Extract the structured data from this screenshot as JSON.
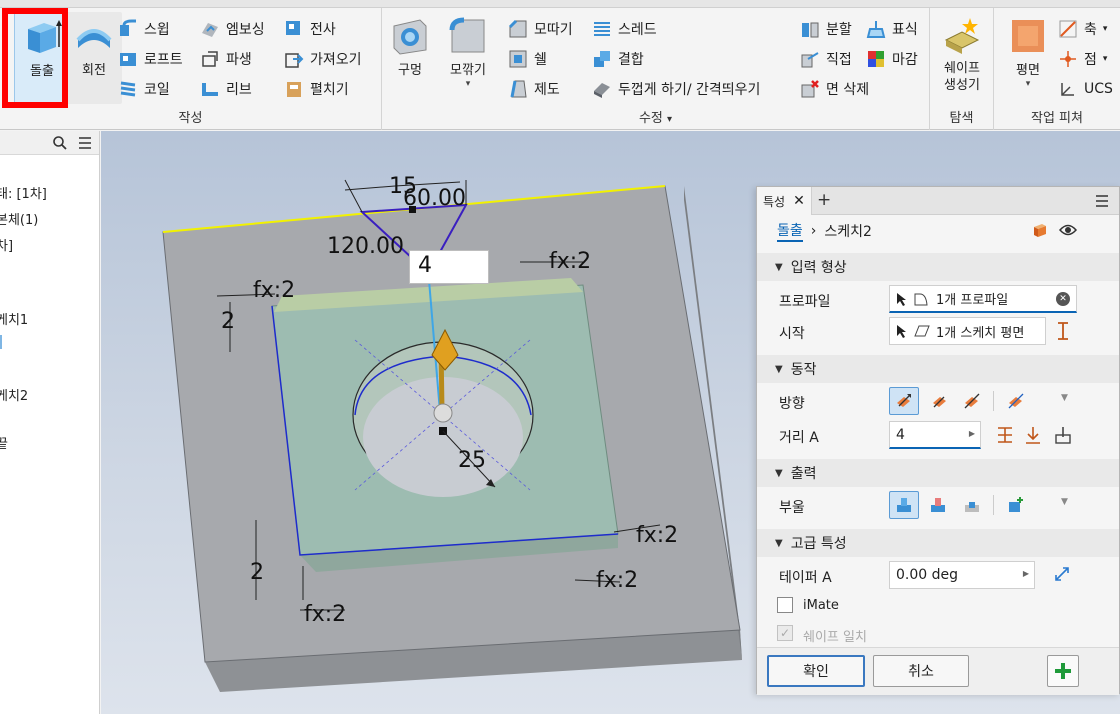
{
  "ribbon": {
    "groups": {
      "create_label": "작성",
      "modify_label": "수정",
      "explore_label": "탐색",
      "workfeature_label": "작업 피쳐"
    },
    "create": {
      "extrude": "돌출",
      "revolve": "회전",
      "sweep": "스윕",
      "loft": "로프트",
      "coil": "코일",
      "emboss": "엠보싱",
      "derive": "파생",
      "rib": "리브",
      "decal": "전사",
      "import": "가져오기",
      "unfold": "펼치기"
    },
    "modify": {
      "hole": "구멍",
      "fillet": "모깎기",
      "chamfer": "모따기",
      "shell": "쉘",
      "draft": "제도",
      "thread": "스레드",
      "combine": "결합",
      "thicken": "두껍게 하기/ 간격띄우기",
      "split": "분할",
      "direct": "직접",
      "delete_face": "면 삭제",
      "mark": "표식",
      "finish": "마감"
    },
    "explore": {
      "shape_generator": "쉐이프\n생성기"
    },
    "workfeatures": {
      "plane": "평면",
      "axis": "축",
      "point": "점",
      "ucs": "UCS"
    }
  },
  "browser": {
    "items": [
      "태: [1차]",
      "본체(1)",
      "차]",
      "케치1",
      "케치2",
      "끝"
    ]
  },
  "viewport": {
    "dims": {
      "chamfer_small": "15",
      "angle_60": "60.00",
      "angle_120": "120.00",
      "distance_input": "4",
      "fx_top_right": "fx:2",
      "fx_top_left": "fx:2",
      "left_top": "2",
      "left_bottom": "2",
      "fx_bottom_left": "fx:2",
      "fx_right_1": "fx:2",
      "fx_right_2": "fx:2",
      "hole_dia": "25"
    }
  },
  "properties": {
    "tab_label": "특성",
    "breadcrumb_feature": "돌출",
    "breadcrumb_sketch": "스케치2",
    "sections": {
      "input_geometry": "입력 형상",
      "behavior": "동작",
      "output": "출력",
      "advanced": "고급 특성"
    },
    "profile_label": "프로파일",
    "profile_value": "1개 프로파일",
    "start_label": "시작",
    "start_value": "1개 스케치 평면",
    "direction_label": "방향",
    "distance_label": "거리 A",
    "distance_value": "4",
    "boolean_label": "부울",
    "taper_label": "테이퍼 A",
    "taper_value": "0.00 deg",
    "imate_label": "iMate",
    "match_shape_label": "쉐이프 일치",
    "ok_label": "확인",
    "cancel_label": "취소"
  }
}
